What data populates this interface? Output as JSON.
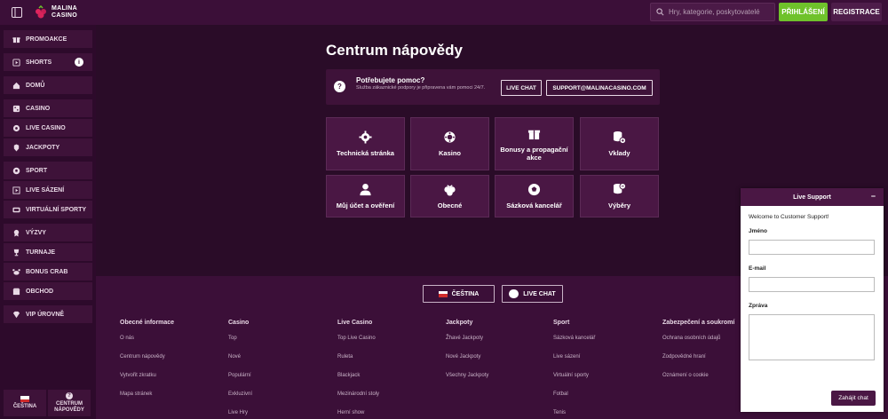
{
  "header": {
    "logo_line1": "MALINA",
    "logo_line2": "CASINO",
    "search_placeholder": "Hry, kategorie, poskytovatelé",
    "login_label": "PŘIHLÁŠENÍ",
    "register_label": "REGISTRACE"
  },
  "sidebar": {
    "items": [
      {
        "label": "PROMOAKCE",
        "icon": "gift-icon"
      },
      {
        "label": "SHORTS",
        "icon": "shorts-icon"
      },
      {
        "label": "DOMŮ",
        "icon": "home-icon"
      },
      {
        "label": "CASINO",
        "icon": "dice-icon"
      },
      {
        "label": "LIVE CASINO",
        "icon": "live-casino-icon"
      },
      {
        "label": "JACKPOTY",
        "icon": "jackpot-icon"
      },
      {
        "label": "SPORT",
        "icon": "soccer-ball-icon"
      },
      {
        "label": "LIVE SÁZENÍ",
        "icon": "live-bet-icon"
      },
      {
        "label": "VIRTUÁLNÍ SPORTY",
        "icon": "virtual-sports-icon"
      },
      {
        "label": "VÝZVY",
        "icon": "medal-icon"
      },
      {
        "label": "TURNAJE",
        "icon": "trophy-icon"
      },
      {
        "label": "BONUS CRAB",
        "icon": "crab-icon"
      },
      {
        "label": "OBCHOD",
        "icon": "shop-icon"
      },
      {
        "label": "VIP ÚROVNĚ",
        "icon": "vip-icon"
      }
    ],
    "info_badge": "i",
    "language_label": "ČEŠTINA",
    "help_label_1": "CENTRUM",
    "help_label_2": "NÁPOVĚDY"
  },
  "main": {
    "title": "Centrum nápovědy",
    "help_box": {
      "title": "Potřebujete pomoc?",
      "subtitle": "Služba zákaznické podpory je připravena vám pomoci 24/7.",
      "live_chat_label": "LIVE CHAT",
      "email_label": "SUPPORT@MALINACASINO.COM"
    },
    "categories": [
      {
        "label": "Technická stránka",
        "icon": "gear-icon"
      },
      {
        "label": "Kasino",
        "icon": "casino-chip-icon"
      },
      {
        "label": "Bonusy a propagační akce",
        "icon": "gift-icon"
      },
      {
        "label": "Vklady",
        "icon": "coins-plus-icon"
      },
      {
        "label": "Můj účet a ověření",
        "icon": "user-icon"
      },
      {
        "label": "Obecné",
        "icon": "malina-icon"
      },
      {
        "label": "Sázková kancelář",
        "icon": "soccer-ball-icon"
      },
      {
        "label": "Výběry",
        "icon": "coins-minus-icon"
      }
    ]
  },
  "footer": {
    "language_button": "ČEŠTINA",
    "live_chat_button": "LIVE CHAT",
    "columns": [
      {
        "heading": "Obecné informace",
        "links": [
          "O nás",
          "Centrum nápovědy",
          "Vytvořit zkratku",
          "Mapa stránek"
        ]
      },
      {
        "heading": "Casino",
        "links": [
          "Top",
          "Nové",
          "Populární",
          "Exkluzivní",
          "Live Hry"
        ]
      },
      {
        "heading": "Live Casino",
        "links": [
          "Top Live Casino",
          "Ruleta",
          "Blackjack",
          "Mezinárodní stoly",
          "Herní show"
        ]
      },
      {
        "heading": "Jackpoty",
        "links": [
          "Žhavé Jackpoty",
          "Nové Jackpoty",
          "Všechny Jackpoty"
        ]
      },
      {
        "heading": "Sport",
        "links": [
          "Sázková kancelář",
          "Live sázení",
          "Virtuální sporty",
          "Fotbal",
          "Tenis"
        ]
      },
      {
        "heading": "Zabezpečení a soukromí",
        "links": [
          "Ochrana osobních údajů",
          "Zodpovědné hraní",
          "Oznámení o cookie"
        ]
      }
    ]
  },
  "live_support": {
    "title": "Live Support",
    "minimize": "−",
    "welcome": "Welcome to Customer Support!",
    "name_label": "Jméno",
    "email_label": "E-mail",
    "message_label": "Zpráva",
    "start_chat": "Zahájit chat"
  },
  "colors": {
    "background": "#2a0c28",
    "panel": "#3e1239",
    "tile": "#4a1744",
    "login": "#6fc22b"
  }
}
